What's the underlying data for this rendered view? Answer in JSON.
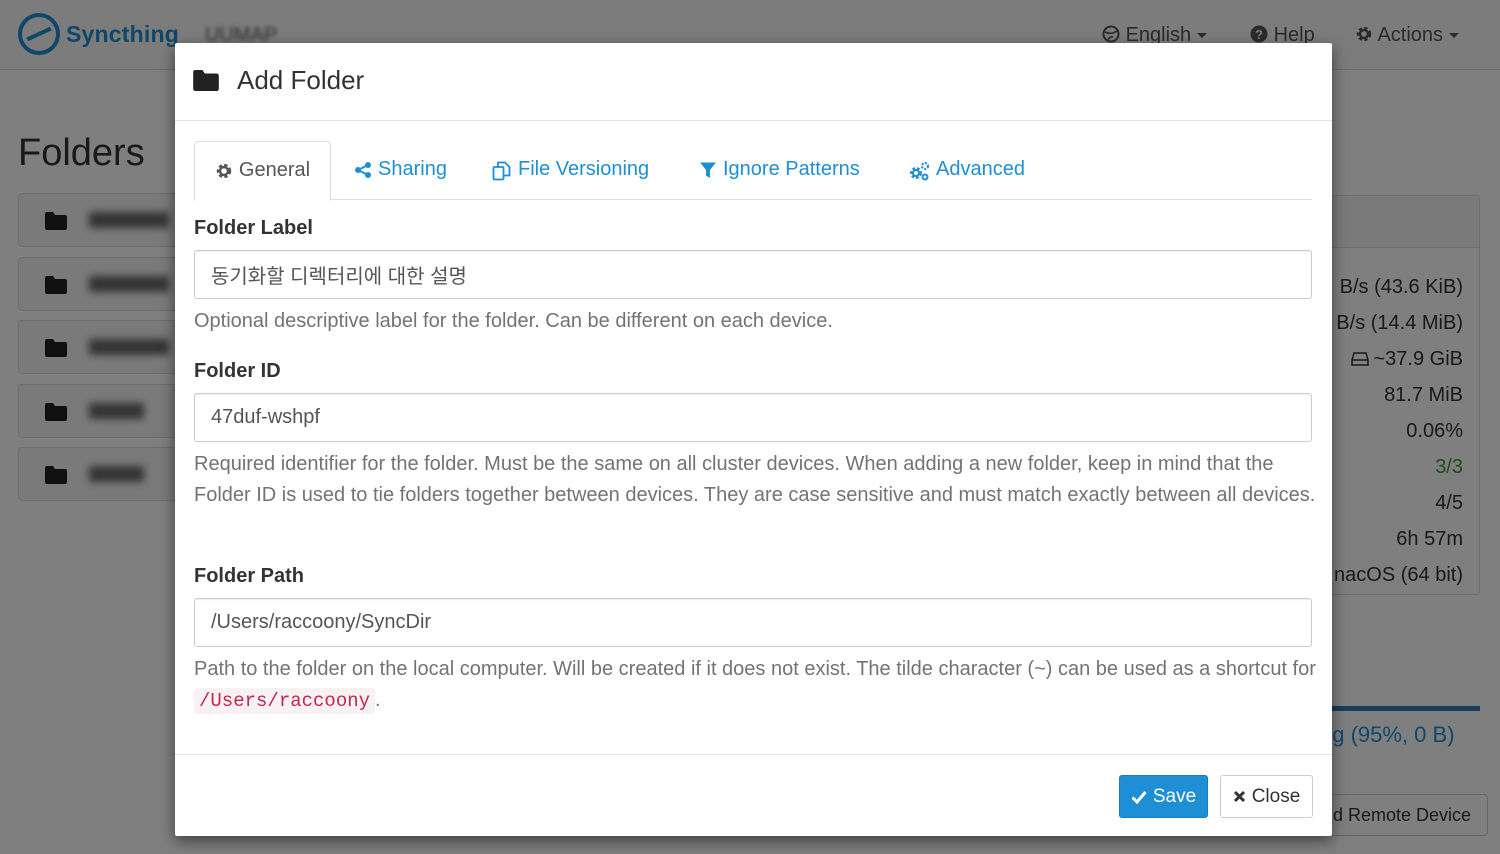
{
  "navbar": {
    "brand": "Syncthing",
    "host": "UUMAP",
    "language": "English",
    "help": "Help",
    "actions": "Actions"
  },
  "page": {
    "heading": "Folders"
  },
  "device_stats": {
    "download_rate": "B/s (43.6 KiB)",
    "upload_rate": "B/s (14.4 MiB)",
    "local_state": "~37.9 GiB",
    "ram": "81.7 MiB",
    "cpu": "0.06%",
    "listeners": "3/3",
    "discovery": "4/5",
    "uptime": "6h 57m",
    "version": "nacOS (64 bit)",
    "sync_status": "ng (95%, 0 B)",
    "add_remote_device": "d Remote Device"
  },
  "modal": {
    "title": "Add Folder",
    "tabs": [
      {
        "label": "General",
        "icon": "gear-icon"
      },
      {
        "label": "Sharing",
        "icon": "share-icon"
      },
      {
        "label": "File Versioning",
        "icon": "files-icon"
      },
      {
        "label": "Ignore Patterns",
        "icon": "filter-icon"
      },
      {
        "label": "Advanced",
        "icon": "cogs-icon"
      }
    ],
    "folder_label": {
      "label": "Folder Label",
      "value": "동기화할 디렉터리에 대한 설명",
      "help": "Optional descriptive label for the folder. Can be different on each device."
    },
    "folder_id": {
      "label": "Folder ID",
      "value": "47duf-wshpf",
      "help": "Required identifier for the folder. Must be the same on all cluster devices. When adding a new folder, keep in mind that the Folder ID is used to tie folders together between devices. They are case sensitive and must match exactly between all devices."
    },
    "folder_path": {
      "label": "Folder Path",
      "value": "/Users/raccoony/SyncDir",
      "help_prefix": "Path to the folder on the local computer. Will be created if it does not exist. The tilde character (~) can be used as a shortcut for",
      "help_code": "/Users/raccoony",
      "help_suffix": "."
    },
    "buttons": {
      "save": "Save",
      "close": "Close"
    }
  },
  "colors": {
    "accent": "#1e8fd4",
    "code": "#c7254e",
    "success": "#3b9a3b"
  }
}
